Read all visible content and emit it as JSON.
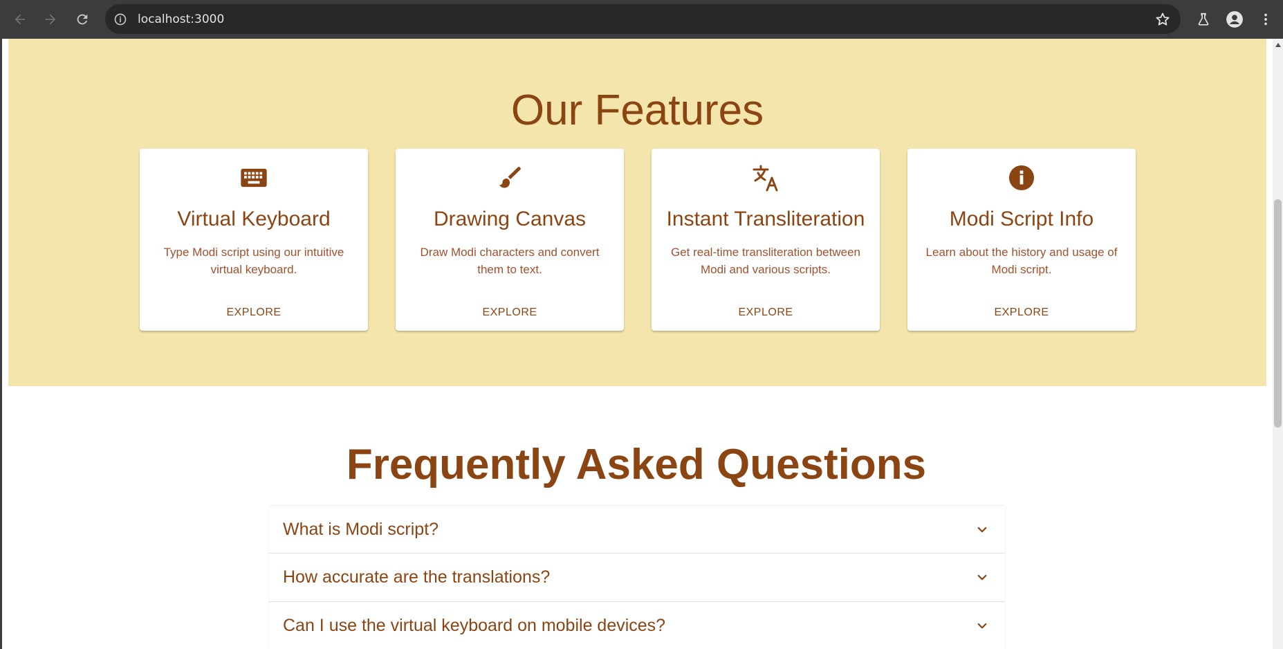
{
  "browser": {
    "url": "localhost:3000",
    "icons": [
      "back-icon",
      "forward-icon",
      "reload-icon",
      "site-info-icon",
      "bookmark-star-icon",
      "labs-flask-icon",
      "profile-icon",
      "menu-dots-icon"
    ]
  },
  "features": {
    "title": "Our Features",
    "cards": [
      {
        "icon": "keyboard-icon",
        "title": "Virtual Keyboard",
        "description": "Type Modi script using our intuitive virtual keyboard.",
        "action": "EXPLORE"
      },
      {
        "icon": "brush-icon",
        "title": "Drawing Canvas",
        "description": "Draw Modi characters and convert them to text.",
        "action": "EXPLORE"
      },
      {
        "icon": "translate-icon",
        "title": "Instant Transliteration",
        "description": "Get real-time transliteration between Modi and various scripts.",
        "action": "EXPLORE"
      },
      {
        "icon": "info-icon",
        "title": "Modi Script Info",
        "description": "Learn about the history and usage of Modi script.",
        "action": "EXPLORE"
      }
    ]
  },
  "faq": {
    "title": "Frequently Asked Questions",
    "items": [
      {
        "question": "What is Modi script?"
      },
      {
        "question": "How accurate are the translations?"
      },
      {
        "question": "Can I use the virtual keyboard on mobile devices?"
      }
    ]
  },
  "colors": {
    "brand": "#8b4513",
    "secondary_text": "#a0522d",
    "features_bg": "#f3e5ab"
  }
}
